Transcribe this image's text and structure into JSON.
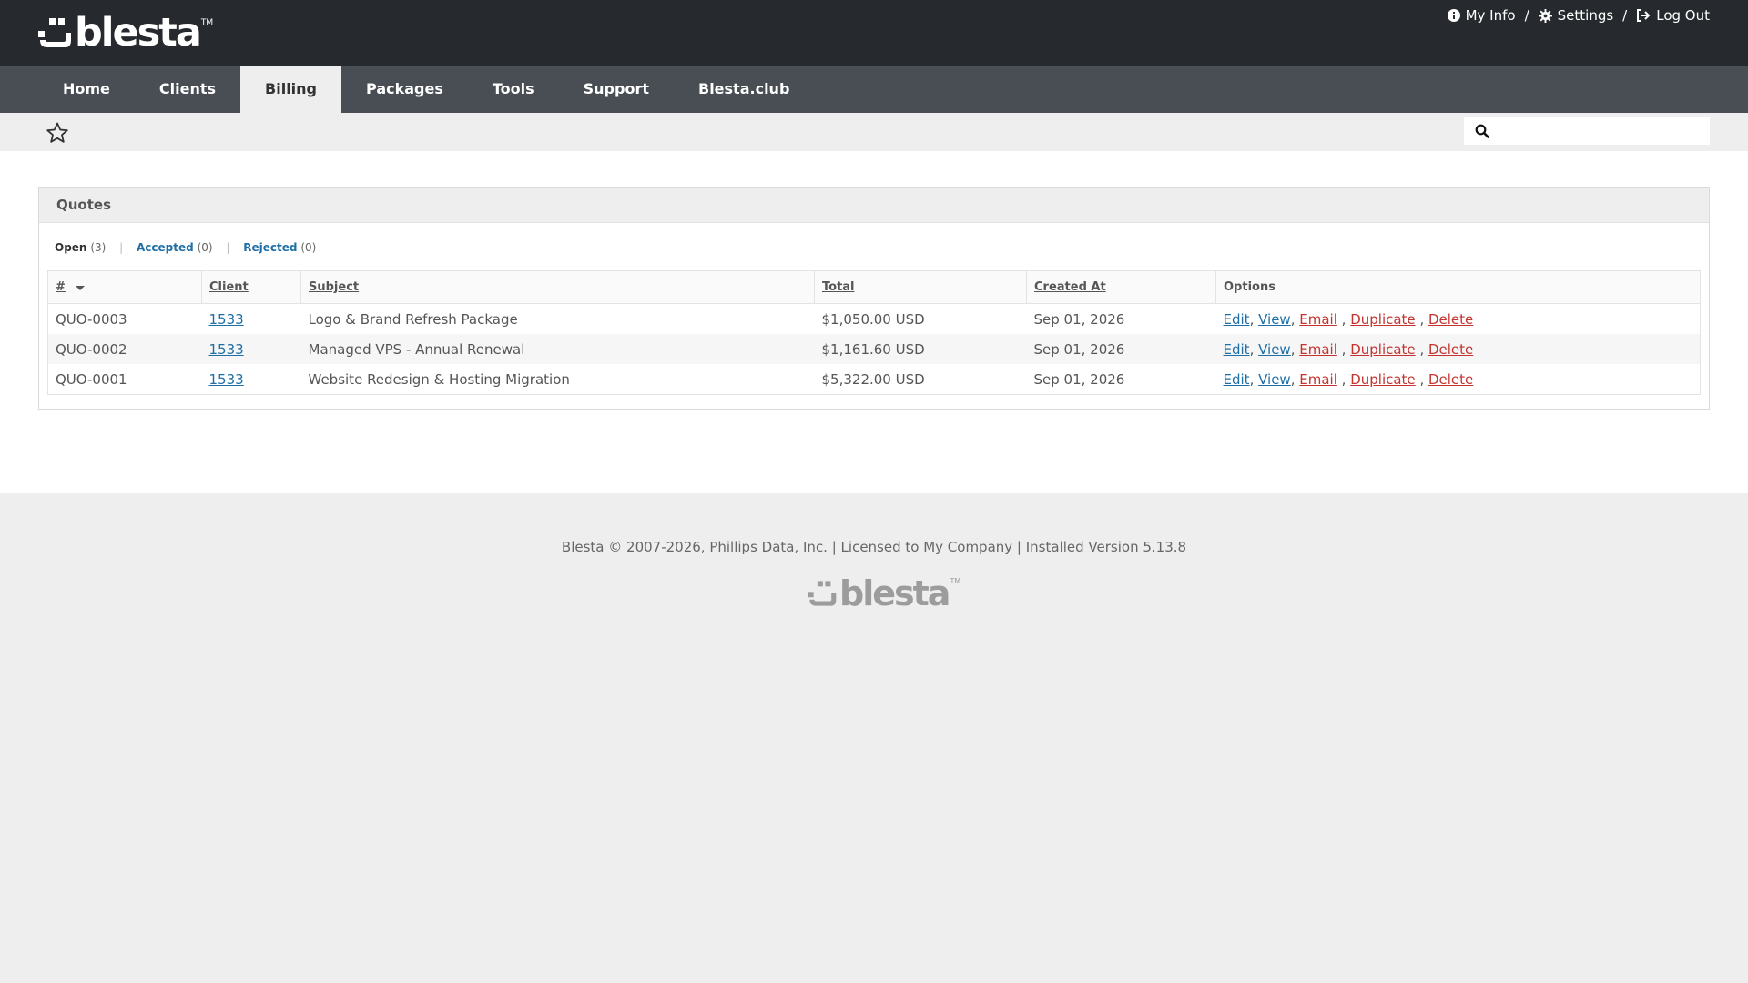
{
  "header": {
    "logo_text": "blesta",
    "logo_tm": "TM",
    "links": {
      "my_info": "My Info",
      "settings": "Settings",
      "log_out": "Log Out",
      "separator": "/"
    }
  },
  "nav": {
    "tabs": [
      {
        "label": "Home"
      },
      {
        "label": "Clients"
      },
      {
        "label": "Billing",
        "active": true
      },
      {
        "label": "Packages"
      },
      {
        "label": "Tools"
      },
      {
        "label": "Support"
      },
      {
        "label": "Blesta.club"
      }
    ]
  },
  "search": {
    "placeholder": ""
  },
  "quotes": {
    "title": "Quotes",
    "filters": [
      {
        "label": "Open",
        "count": "(3)",
        "active": true
      },
      {
        "label": "Accepted",
        "count": "(0)"
      },
      {
        "label": "Rejected",
        "count": "(0)"
      }
    ],
    "columns": {
      "number": "#",
      "client": "Client",
      "subject": "Subject",
      "total": "Total",
      "created_at": "Created At",
      "options": "Options"
    },
    "rows": [
      {
        "number": "QUO-0003",
        "client": "1533",
        "subject": "Logo & Brand Refresh Package",
        "total": "$1,050.00 USD",
        "created_at": "Sep 01, 2026"
      },
      {
        "number": "QUO-0002",
        "client": "1533",
        "subject": "Managed VPS - Annual Renewal",
        "total": "$1,161.60 USD",
        "created_at": "Sep 01, 2026"
      },
      {
        "number": "QUO-0001",
        "client": "1533",
        "subject": "Website Redesign & Hosting Migration",
        "total": "$5,322.00 USD",
        "created_at": "Sep 01, 2026"
      }
    ],
    "options": {
      "edit": "Edit",
      "view": "View",
      "email": "Email",
      "duplicate": "Duplicate",
      "delete": "Delete"
    }
  },
  "footer": {
    "copyright": "Blesta © 2007-2026, Phillips Data, Inc. | Licensed to My Company | Installed Version 5.13.8",
    "logo_text": "blesta",
    "logo_tm": "TM"
  },
  "colors": {
    "header_bg": "#262a2e",
    "nav_bg": "#494e54",
    "link_blue": "#1f6fa6",
    "link_red": "#c4332f",
    "page_bg": "#eeeeee"
  }
}
